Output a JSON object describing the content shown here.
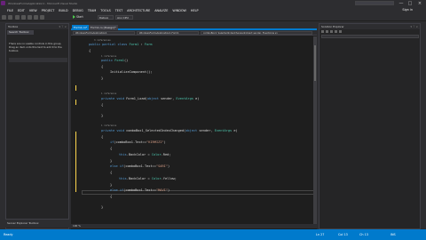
{
  "window": {
    "title": "WindowsFormsApplication1 - Microsoft Visual Studio",
    "buttons": [
      "—",
      "□",
      "×"
    ]
  },
  "menu": [
    "FILE",
    "EDIT",
    "VIEW",
    "PROJECT",
    "BUILD",
    "DEBUG",
    "TEAM",
    "TOOLS",
    "TEST",
    "ARCHITECTURE",
    "ANALYZE",
    "WINDOW",
    "HELP"
  ],
  "signin": "Sign in",
  "toolbar": {
    "config": "Debug",
    "platform": "Any CPU",
    "start_label": "Start"
  },
  "left_panel": {
    "title": "Toolbox",
    "tab": "Search Toolbox",
    "message": "There are no usable controls in this group. Drag an item onto this text to add it to the toolbox.",
    "bottom": "Server Explorer   Toolbox"
  },
  "editor": {
    "tabs": [
      "Form1.cs*",
      "Form1.cs [Design]*"
    ],
    "nav": [
      "WindowsFormsApplication1",
      "WindowsFormsApplication1.Form1",
      "comboBox1_SelectedIndexChanged(object sender, EventArgs e)"
    ],
    "zoom": "100 %"
  },
  "code": {
    "ref0": "3 references",
    "l_class": [
      "public",
      " partial ",
      "class",
      " ",
      "Form1",
      " : ",
      "Form"
    ],
    "l_open1": "{",
    "ref1": "1 reference",
    "l_ctor": [
      "public",
      " ",
      "Form1",
      "()"
    ],
    "l_open2": "{",
    "l_init": "InitializeComponent();",
    "l_close2": "}",
    "ref2": "1 reference",
    "l_load": [
      "private",
      " ",
      "void",
      " Form1_Load(",
      "object",
      " sender, ",
      "EventArgs",
      " e)"
    ],
    "l_open3": "{",
    "l_close3": "}",
    "ref3": "1 reference",
    "l_combo": [
      "private",
      " ",
      "void",
      " comboBox1_SelectedIndexChanged(",
      "object",
      " sender, ",
      "EventArgs",
      " e)"
    ],
    "l_open4": "{",
    "l_if1": [
      "if",
      "(comboBox1.Text==",
      "\"KIRMIZI\"",
      ")"
    ],
    "l_open5": "{",
    "l_red": [
      "this",
      ".BackColor = ",
      "Color",
      ".Red;"
    ],
    "l_close5": "}",
    "l_elif1": [
      "else",
      " ",
      "if",
      "(comboBox1.Text==",
      "\"SARI\"",
      ")"
    ],
    "l_open6": "{",
    "l_yellow": [
      "this",
      ".BackColor = ",
      "Color",
      ".Yellow;"
    ],
    "l_close6": "}",
    "l_elif2": [
      "else",
      " ",
      "if",
      "(comboBox1.Text==",
      "\"MAVI\"",
      ")"
    ],
    "l_open7": "{",
    "l_close7": "}",
    "l_close1": "}"
  },
  "right_panel": {
    "title": "Solution Explorer"
  },
  "status": {
    "left": "Ready",
    "ln": "Ln 27",
    "col": "Col 13",
    "ch": "Ch 13",
    "mode": "INS"
  },
  "colors": {
    "accent": "#007acc",
    "keyword": "#569cd6",
    "type": "#4ec9b0",
    "string": "#d69d85",
    "editor_bg": "#1e1e1e"
  }
}
